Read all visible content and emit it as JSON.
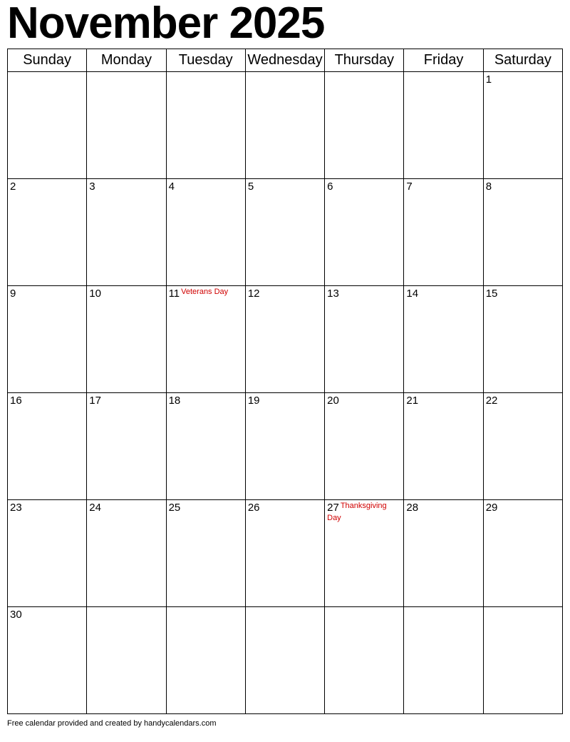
{
  "title": "November 2025",
  "weekdays": [
    "Sunday",
    "Monday",
    "Tuesday",
    "Wednesday",
    "Thursday",
    "Friday",
    "Saturday"
  ],
  "weeks": [
    [
      {
        "day": "",
        "holiday": ""
      },
      {
        "day": "",
        "holiday": ""
      },
      {
        "day": "",
        "holiday": ""
      },
      {
        "day": "",
        "holiday": ""
      },
      {
        "day": "",
        "holiday": ""
      },
      {
        "day": "",
        "holiday": ""
      },
      {
        "day": "1",
        "holiday": ""
      }
    ],
    [
      {
        "day": "2",
        "holiday": ""
      },
      {
        "day": "3",
        "holiday": ""
      },
      {
        "day": "4",
        "holiday": ""
      },
      {
        "day": "5",
        "holiday": ""
      },
      {
        "day": "6",
        "holiday": ""
      },
      {
        "day": "7",
        "holiday": ""
      },
      {
        "day": "8",
        "holiday": ""
      }
    ],
    [
      {
        "day": "9",
        "holiday": ""
      },
      {
        "day": "10",
        "holiday": ""
      },
      {
        "day": "11",
        "holiday": "Veterans Day"
      },
      {
        "day": "12",
        "holiday": ""
      },
      {
        "day": "13",
        "holiday": ""
      },
      {
        "day": "14",
        "holiday": ""
      },
      {
        "day": "15",
        "holiday": ""
      }
    ],
    [
      {
        "day": "16",
        "holiday": ""
      },
      {
        "day": "17",
        "holiday": ""
      },
      {
        "day": "18",
        "holiday": ""
      },
      {
        "day": "19",
        "holiday": ""
      },
      {
        "day": "20",
        "holiday": ""
      },
      {
        "day": "21",
        "holiday": ""
      },
      {
        "day": "22",
        "holiday": ""
      }
    ],
    [
      {
        "day": "23",
        "holiday": ""
      },
      {
        "day": "24",
        "holiday": ""
      },
      {
        "day": "25",
        "holiday": ""
      },
      {
        "day": "26",
        "holiday": ""
      },
      {
        "day": "27",
        "holiday": "Thanksgiving Day"
      },
      {
        "day": "28",
        "holiday": ""
      },
      {
        "day": "29",
        "holiday": ""
      }
    ],
    [
      {
        "day": "30",
        "holiday": ""
      },
      {
        "day": "",
        "holiday": ""
      },
      {
        "day": "",
        "holiday": ""
      },
      {
        "day": "",
        "holiday": ""
      },
      {
        "day": "",
        "holiday": ""
      },
      {
        "day": "",
        "holiday": ""
      },
      {
        "day": "",
        "holiday": ""
      }
    ]
  ],
  "footer": "Free calendar provided and created by handycalendars.com"
}
